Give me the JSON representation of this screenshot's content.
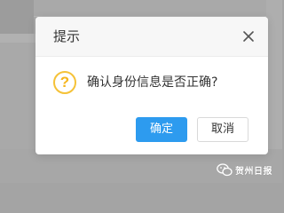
{
  "dialog": {
    "title": "提示",
    "close_icon": "close-icon",
    "icon": "question-circle-icon",
    "icon_glyph": "?",
    "message": "确认身份信息是否正确?",
    "confirm_label": "确定",
    "cancel_label": "取消"
  },
  "watermark": {
    "icon": "wechat-icon",
    "text": "贺州日报"
  },
  "colors": {
    "primary_button": "#2d9bef",
    "question_icon": "#f5c238",
    "overlay": "#a9a9a9"
  }
}
